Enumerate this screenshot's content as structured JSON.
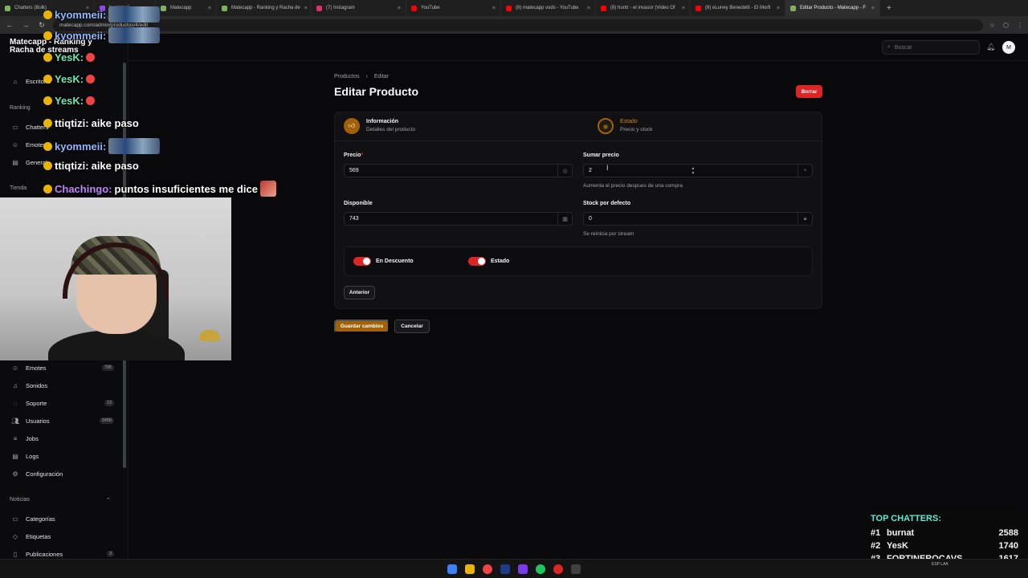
{
  "browser": {
    "tabs": [
      {
        "label": "Chatters (Bulk)",
        "color": "#7fb55a"
      },
      {
        "label": "kyommeii",
        "color": "#9146ff"
      },
      {
        "label": "Matecapp",
        "color": "#7fb55a"
      },
      {
        "label": "Matecapp - Ranking y Racha de",
        "color": "#7fb55a"
      },
      {
        "label": "(7) Instagram",
        "color": "#e1306c"
      },
      {
        "label": "YouTube",
        "color": "#ff0000"
      },
      {
        "label": "(8) matecapp vods - YouTube",
        "color": "#ff0000"
      },
      {
        "label": "(8) huntr - el invasor (Video Of",
        "color": "#ff0000"
      },
      {
        "label": "(8) eLuney Benedetti - El Morfi",
        "color": "#ff0000"
      },
      {
        "label": "Editar Producto - Matecapp - F",
        "color": "#7fb55a"
      }
    ],
    "url": "matecapp.com/admin/productos/4/edit"
  },
  "app": {
    "brand": "Matecapp - Ranking y Racha de streams",
    "search_placeholder": "Buscar",
    "avatar": "M"
  },
  "sidebar": {
    "dashboard": "Escritorio",
    "group_ranking": "Ranking",
    "chatters": "Chatters",
    "emotes_top": "Emotes",
    "general": "General",
    "group_tienda": "Tienda",
    "items": [
      {
        "label": "Emotes",
        "badge": "795"
      },
      {
        "label": "Sonidos",
        "badge": ""
      },
      {
        "label": "Soporte",
        "badge": "13"
      },
      {
        "label": "Usuarios",
        "badge": "2458"
      },
      {
        "label": "Jobs",
        "badge": ""
      },
      {
        "label": "Logs",
        "badge": ""
      },
      {
        "label": "Configuración",
        "badge": ""
      }
    ],
    "group_noticias": "Noticias",
    "noticias_items": [
      {
        "label": "Categorías",
        "badge": ""
      },
      {
        "label": "Etiquetas",
        "badge": ""
      },
      {
        "label": "Publicaciones",
        "badge": "3"
      }
    ]
  },
  "page": {
    "breadcrumb_parent": "Productos",
    "breadcrumb_current": "Editar",
    "title": "Editar Producto",
    "delete_label": "Borrar",
    "steps": [
      {
        "title": "Información",
        "subtitle": "Detalles del producto"
      },
      {
        "title": "Estado",
        "subtitle": "Precio y stock"
      }
    ],
    "fields": {
      "precio_label": "Precio",
      "precio_value": "569",
      "sumar_label": "Sumar precio",
      "sumar_value": "2",
      "sumar_hint": "Aumenta el precio despues de una compra",
      "disponible_label": "Disponible",
      "disponible_value": "743",
      "stock_label": "Stock por defecto",
      "stock_value": "0",
      "stock_hint": "Se reinicia por stream"
    },
    "toggles": [
      {
        "label": "En Descuento",
        "on": true
      },
      {
        "label": "Estado",
        "on": true
      }
    ],
    "previous_label": "Anterior",
    "save_label": "Guardar cambios",
    "cancel_label": "Cancelar"
  },
  "stream_chat": [
    {
      "user": "kyommeii:",
      "color": "#8fb8ff",
      "text": ""
    },
    {
      "user": "kyommeii:",
      "color": "#8fb8ff",
      "text": ""
    },
    {
      "user": "YesK:",
      "color": "#6ee7b7",
      "text": ""
    },
    {
      "user": "YesK:",
      "color": "#6ee7b7",
      "text": ""
    },
    {
      "user": "YesK:",
      "color": "#6ee7b7",
      "text": ""
    },
    {
      "user": "ttiqtizi:",
      "color": "#ffffff",
      "text": "aike paso"
    },
    {
      "user": "kyommeii:",
      "color": "#8fb8ff",
      "text": ""
    },
    {
      "user": "ttiqtizi:",
      "color": "#ffffff",
      "text": "aike paso"
    },
    {
      "user": "Chachingo:",
      "color": "#c084fc",
      "text": "puntos insuficientes me dice"
    }
  ],
  "top_chatters": {
    "title": "TOP CHATTERS:",
    "rows": [
      {
        "rank": "#1",
        "name": "burnat",
        "count": "2588"
      },
      {
        "rank": "#2",
        "name": "YesK",
        "count": "1740"
      },
      {
        "rank": "#3",
        "name": "FORTINEROCAVS",
        "count": "1617"
      }
    ]
  },
  "taskbar": {
    "tray_lang": "ESP LAA"
  }
}
